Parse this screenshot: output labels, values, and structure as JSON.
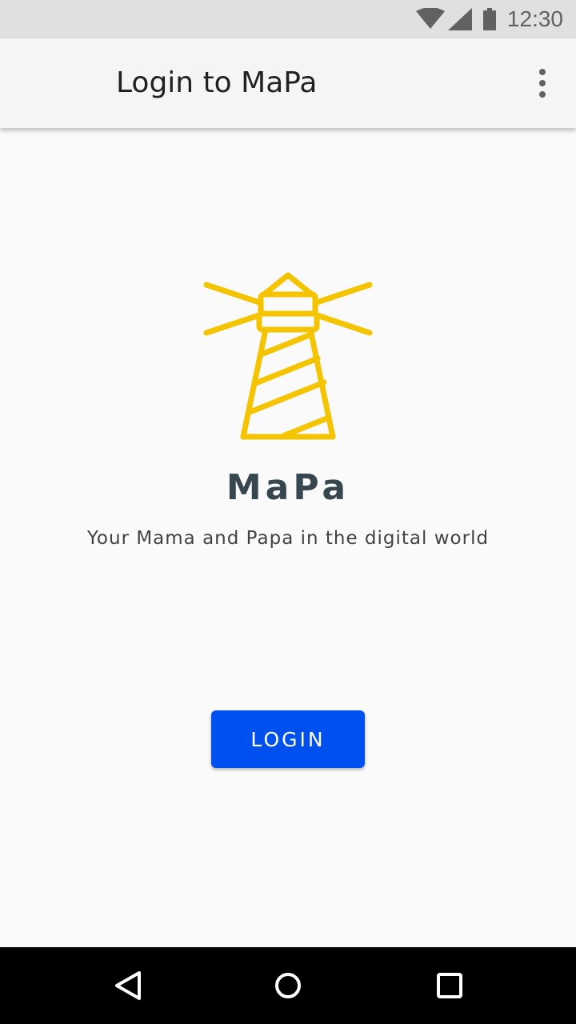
{
  "status_bar": {
    "time": "12:30",
    "icons": [
      "wifi-icon",
      "cell-signal-icon",
      "battery-icon"
    ]
  },
  "app_bar": {
    "title": "Login to MaPa",
    "menu_icon": "more-vert-icon"
  },
  "main": {
    "logo_icon": "lighthouse-icon",
    "brand_name": "MaPa",
    "tagline": "Your Mama and Papa in the digital world",
    "login_label": "LOGIN"
  },
  "nav_bar": {
    "icons": [
      "back-icon",
      "home-icon",
      "recents-icon"
    ]
  },
  "colors": {
    "accent": "#0050f0",
    "logo": "#f5c400",
    "brand_text": "#37474f",
    "app_bar_bg": "#f5f5f5",
    "status_bar_bg": "#e0e0e0"
  }
}
